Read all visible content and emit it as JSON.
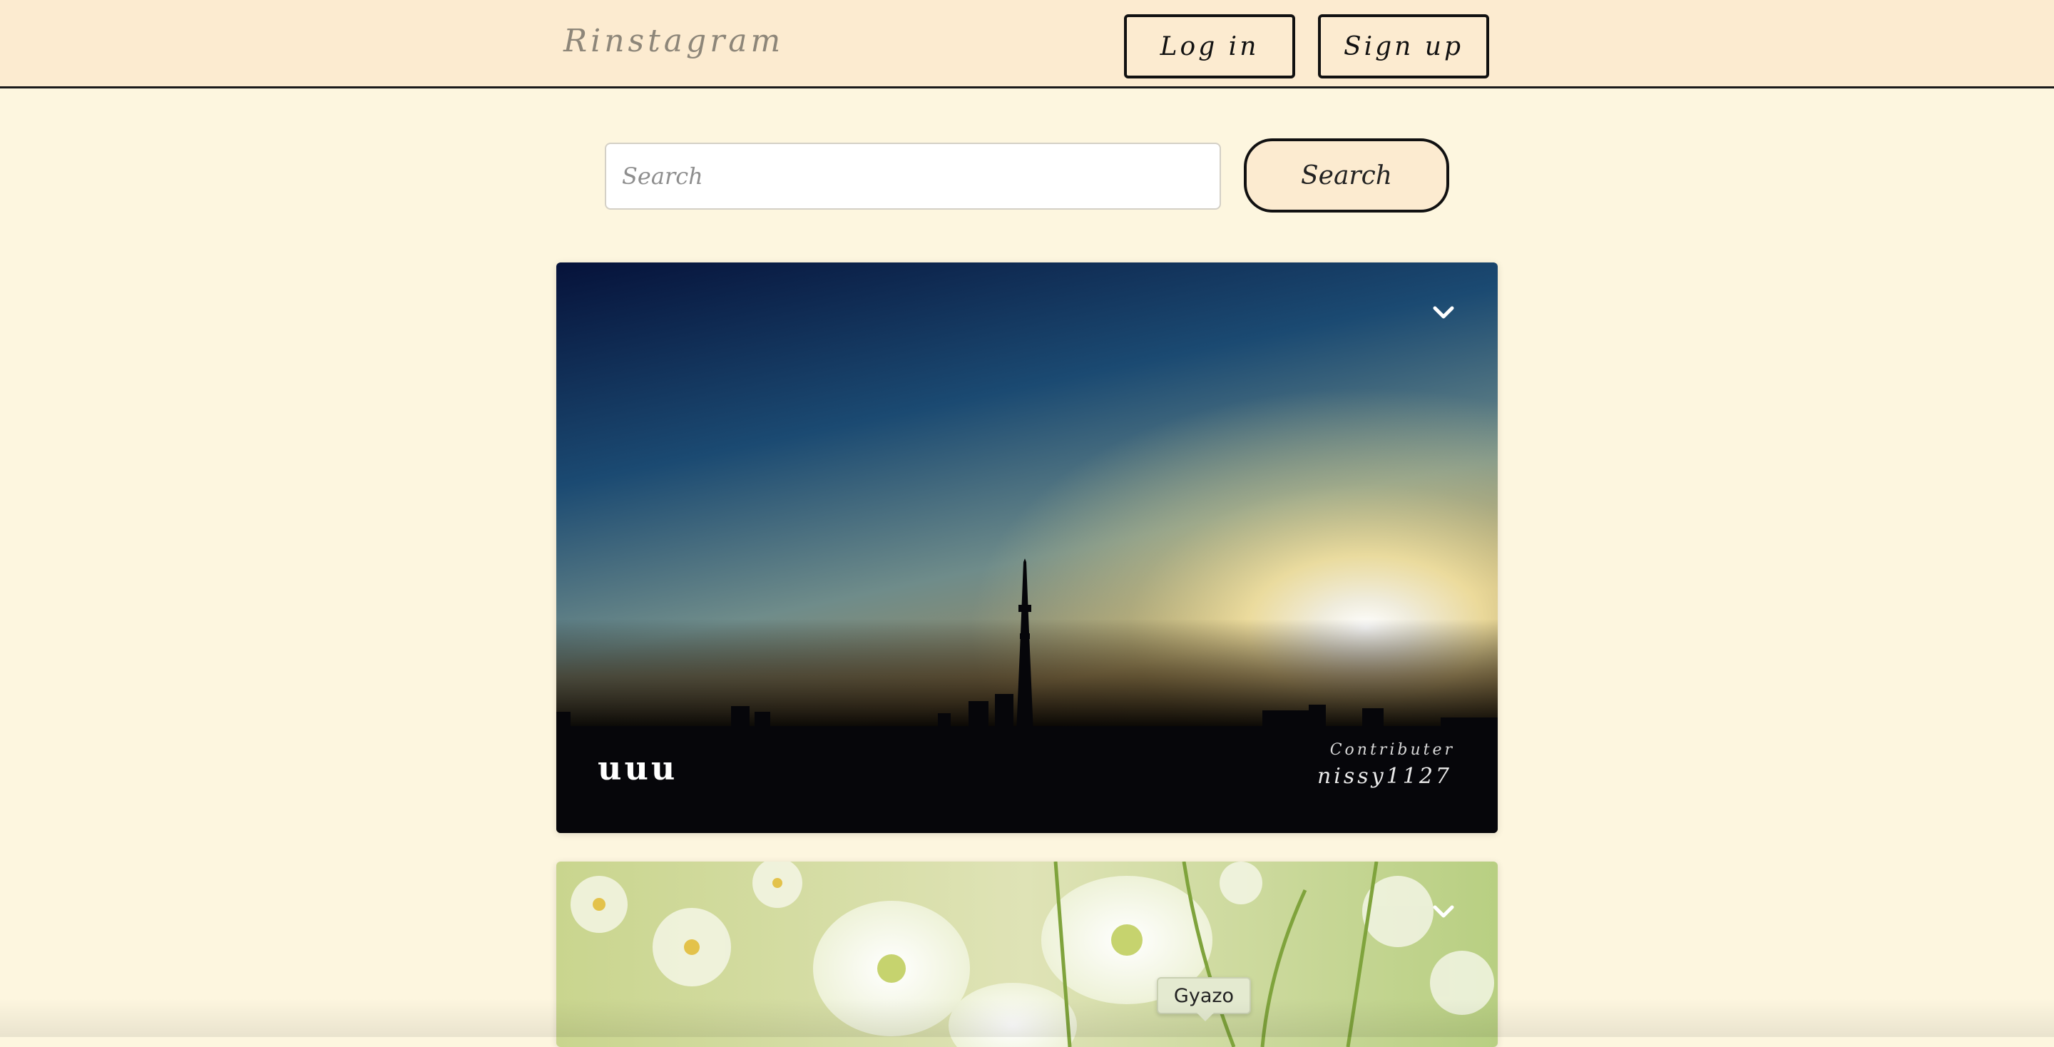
{
  "header": {
    "logo": "Rinstagram",
    "login_label": "Log in",
    "signup_label": "Sign up"
  },
  "search": {
    "placeholder": "Search",
    "button_label": "Search"
  },
  "posts": [
    {
      "title": "uuu",
      "contributor_label": "Contributer",
      "contributor_name": "nissy1127",
      "image": "city-skyline-sunset",
      "menu_icon": "chevron-down-icon"
    },
    {
      "title": "",
      "image": "white-cosmos-flowers",
      "menu_icon": "chevron-down-icon"
    }
  ],
  "tooltip": {
    "label": "Gyazo"
  },
  "colors": {
    "background": "#fdf6df",
    "header": "#fcebd0",
    "border": "#111111"
  }
}
